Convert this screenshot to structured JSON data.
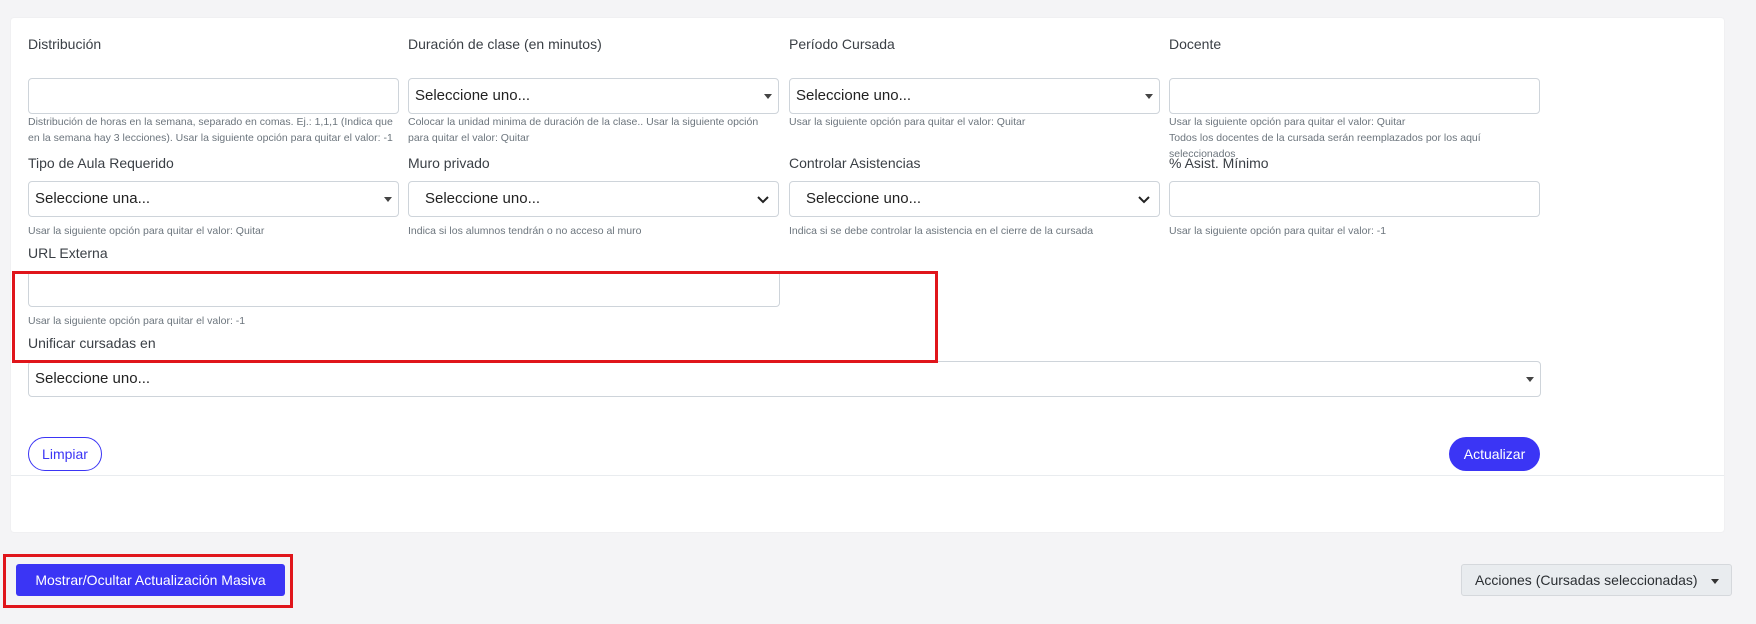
{
  "fields": {
    "distribucion": {
      "label": "Distribución",
      "value": "",
      "help": "Distribución de horas en la semana, separado en comas. Ej.: 1,1,1 (Indica que en la semana hay 3 lecciones). Usar la siguiente opción para quitar el valor: -1"
    },
    "duracion": {
      "label": "Duración de clase (en minutos)",
      "selected": "Seleccione uno...",
      "help": "Colocar la unidad minima de duración de la clase.. Usar la siguiente opción para quitar el valor: Quitar"
    },
    "periodo": {
      "label": "Período Cursada",
      "selected": "Seleccione uno...",
      "help": "Usar la siguiente opción para quitar el valor: Quitar"
    },
    "docente": {
      "label": "Docente",
      "value": "",
      "help": "Usar la siguiente opción para quitar el valor: Quitar",
      "help2": "Todos los docentes de la cursada serán reemplazados por los aquí seleccionados"
    },
    "tipo_aula": {
      "label": "Tipo de Aula Requerido",
      "selected": "Seleccione una...",
      "help": "Usar la siguiente opción para quitar el valor: Quitar"
    },
    "muro_privado": {
      "label": "Muro privado",
      "selected": "Seleccione uno...",
      "help": "Indica si los alumnos tendrán o no acceso al muro"
    },
    "controlar_asistencias": {
      "label": "Controlar Asistencias",
      "selected": "Seleccione uno...",
      "help": "Indica si se debe controlar la asistencia en el cierre de la cursada"
    },
    "asist_minimo": {
      "label": "% Asist. Mínimo",
      "value": "",
      "help": "Usar la siguiente opción para quitar el valor: -1"
    },
    "url_externa": {
      "label": "URL Externa",
      "value": "",
      "help": "Usar la siguiente opción para quitar el valor: -1"
    },
    "unificar": {
      "label": "Unificar cursadas en",
      "selected": "Seleccione uno..."
    }
  },
  "buttons": {
    "limpiar": "Limpiar",
    "actualizar": "Actualizar",
    "mostrar_ocultar": "Mostrar/Ocultar Actualización Masiva",
    "acciones": "Acciones (Cursadas seleccionadas)"
  },
  "colors": {
    "primary": "#3b35f5",
    "highlight": "#e0151b"
  },
  "icons": {
    "select_caret": "caret-down-icon",
    "select_chevron": "chevron-down-icon"
  }
}
